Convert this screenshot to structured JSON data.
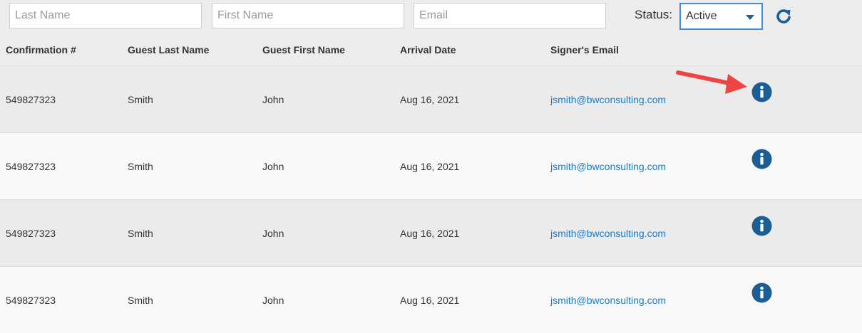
{
  "filters": {
    "last_name_placeholder": "Last Name",
    "first_name_placeholder": "First Name",
    "email_placeholder": "Email",
    "status_label": "Status:",
    "status_value": "Active",
    "refresh_icon": "refresh-icon"
  },
  "table": {
    "columns": [
      "Confirmation #",
      "Guest Last Name",
      "Guest First Name",
      "Arrival Date",
      "Signer's Email"
    ],
    "rows": [
      {
        "confirmation": "549827323",
        "last_name": "Smith",
        "first_name": "John",
        "arrival_date": "Aug 16, 2021",
        "email": "jsmith@bwconsulting.com",
        "action_icon": "info-icon"
      },
      {
        "confirmation": "549827323",
        "last_name": "Smith",
        "first_name": "John",
        "arrival_date": "Aug 16, 2021",
        "email": "jsmith@bwconsulting.com",
        "action_icon": "info-icon"
      },
      {
        "confirmation": "549827323",
        "last_name": "Smith",
        "first_name": "John",
        "arrival_date": "Aug 16, 2021",
        "email": "jsmith@bwconsulting.com",
        "action_icon": "info-icon"
      },
      {
        "confirmation": "549827323",
        "last_name": "Smith",
        "first_name": "John",
        "arrival_date": "Aug 16, 2021",
        "email": "jsmith@bwconsulting.com",
        "action_icon": "info-icon"
      }
    ]
  },
  "annotation": {
    "icon": "red-arrow-icon"
  },
  "colors": {
    "accent": "#1b5e96",
    "link": "#1f7ac2",
    "annotation_arrow": "#ef4444",
    "row_alt_dark": "#ebebeb",
    "row_alt_light": "#f8f8f8"
  }
}
